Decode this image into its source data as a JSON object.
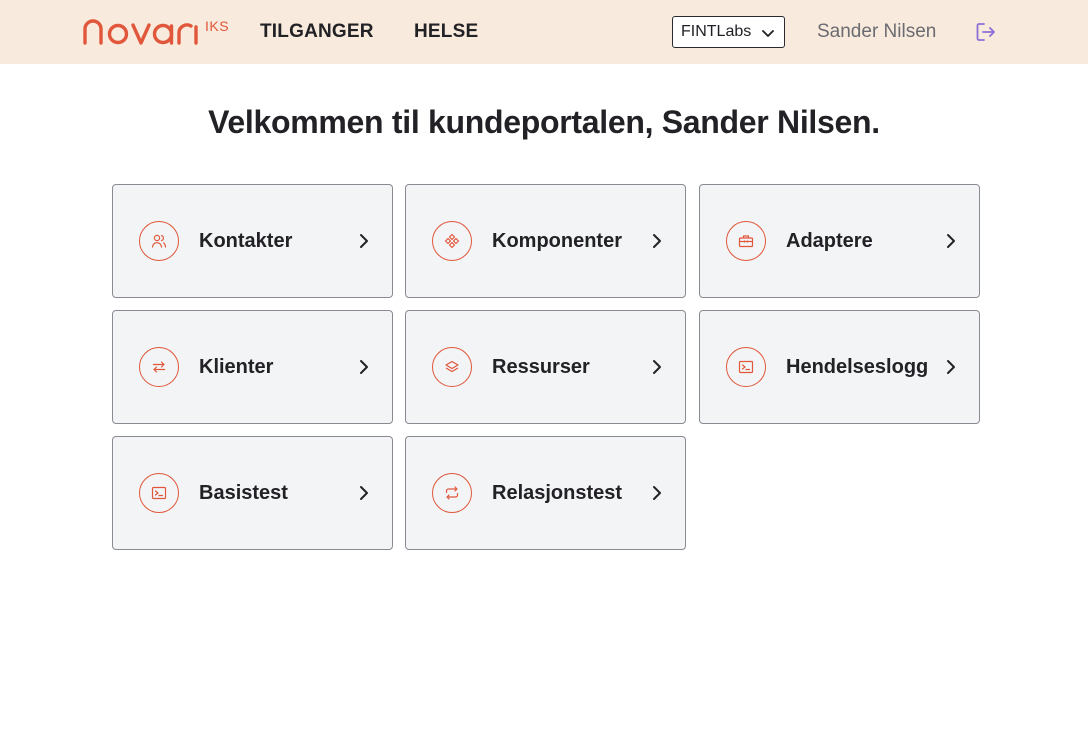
{
  "header": {
    "logo_text": "novari IKS",
    "nav": [
      {
        "label": "TILGANGER"
      },
      {
        "label": "HELSE"
      }
    ],
    "org_select": {
      "value": "FINTLabs"
    },
    "user_name": "Sander Nilsen"
  },
  "main": {
    "title": "Velkommen til kundeportalen, Sander Nilsen.",
    "cards": [
      {
        "label": "Kontakter",
        "icon": "users-icon"
      },
      {
        "label": "Komponenter",
        "icon": "components-icon"
      },
      {
        "label": "Adaptere",
        "icon": "toolbox-icon"
      },
      {
        "label": "Klienter",
        "icon": "swap-arrows-icon"
      },
      {
        "label": "Ressurser",
        "icon": "layers-icon"
      },
      {
        "label": "Hendelseslogg",
        "icon": "terminal-icon"
      },
      {
        "label": "Basistest",
        "icon": "terminal-icon"
      },
      {
        "label": "Relasjonstest",
        "icon": "refresh-icon"
      }
    ]
  },
  "colors": {
    "header_bg": "#f8eadc",
    "accent": "#e0573b",
    "logout_icon": "#8b6fd6",
    "card_bg": "#f3f4f6"
  }
}
